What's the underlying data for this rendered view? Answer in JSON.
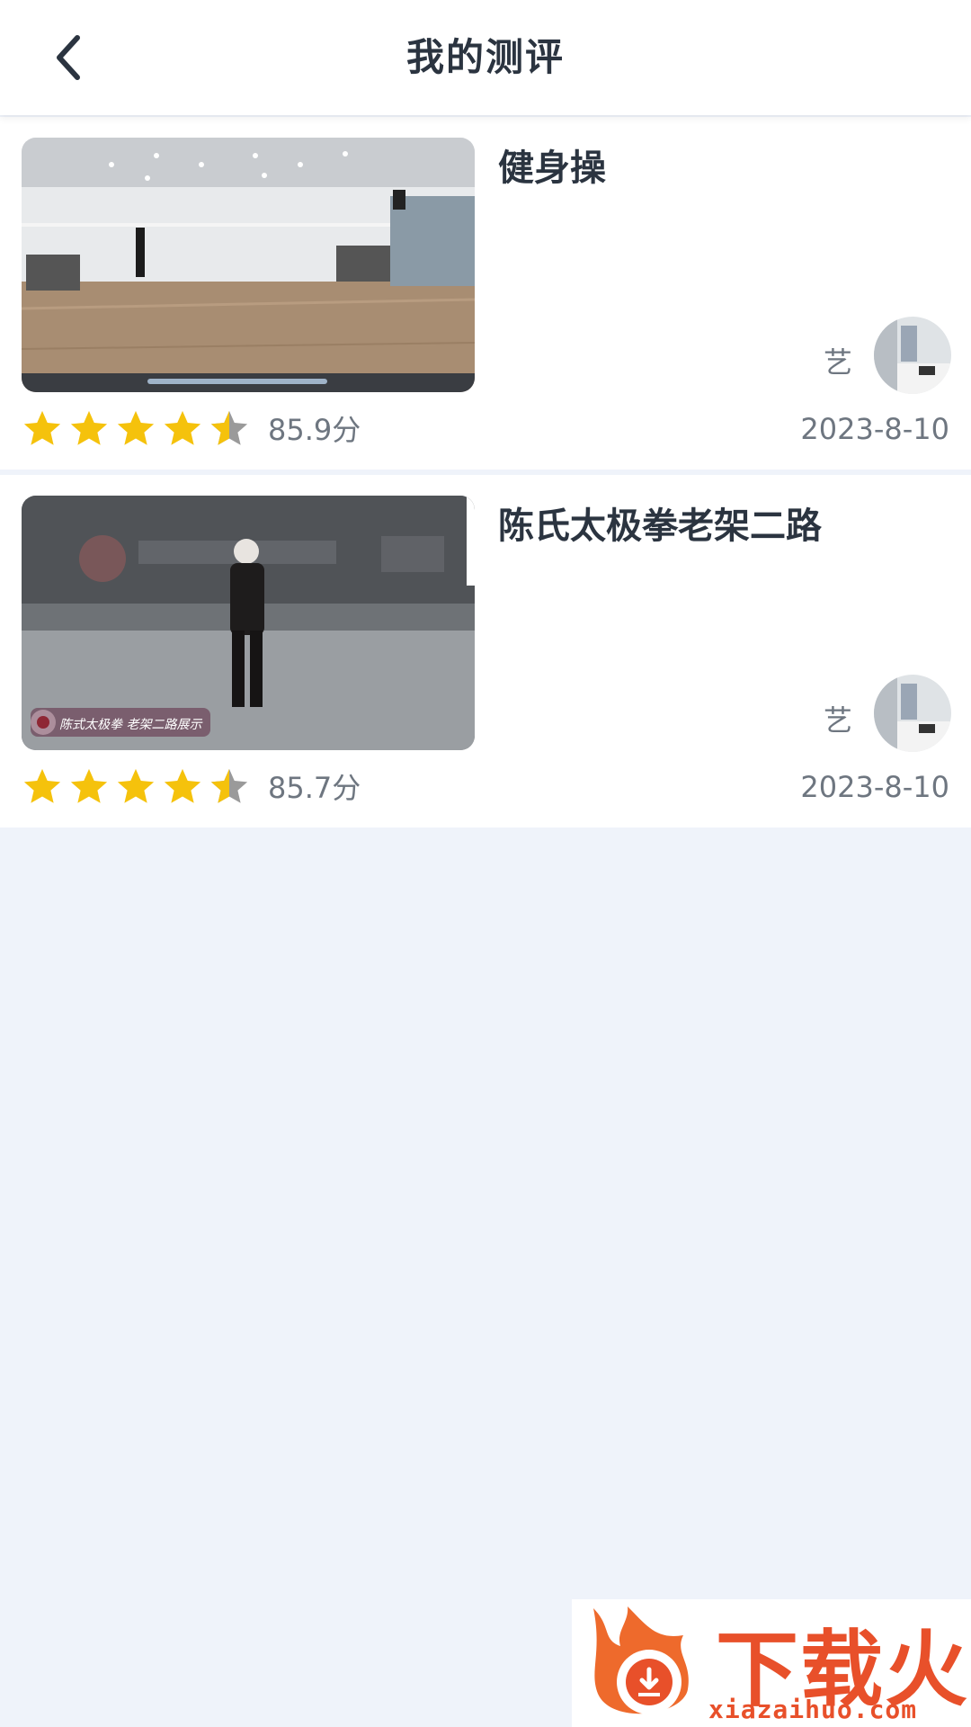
{
  "header": {
    "title": "我的测评"
  },
  "icons": {
    "back": "chevron-left-icon",
    "star": "star-icon",
    "half_star": "half-star-icon"
  },
  "colors": {
    "star": "#f5c20c",
    "star_empty": "#9a9a9a",
    "accent": "#e8502a"
  },
  "items": [
    {
      "title": "健身操",
      "rating_stars": 4.5,
      "score": "85.9分",
      "author": "艺",
      "date": "2023-8-10"
    },
    {
      "title": "陈氏太极拳老架二路",
      "rating_stars": 4.5,
      "score": "85.7分",
      "author": "艺",
      "date": "2023-8-10",
      "thumbnail_caption": "陈式太极拳 老架二路展示"
    }
  ],
  "watermark": {
    "name": "下载火",
    "url": "xiazaihuo.com"
  }
}
